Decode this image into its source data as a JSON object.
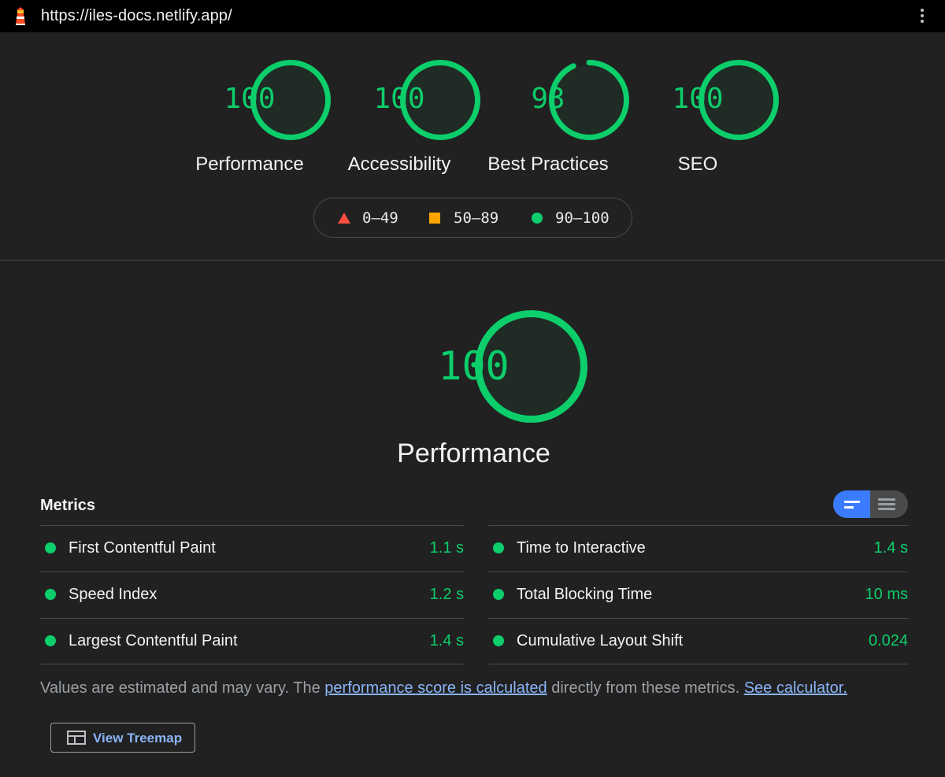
{
  "topbar": {
    "logo_icon": "lighthouse-icon",
    "url": "https://iles-docs.netlify.app/",
    "menu_icon": "kebab-menu-icon"
  },
  "scores": [
    {
      "label": "Performance",
      "value": "100",
      "score": 100
    },
    {
      "label": "Accessibility",
      "value": "100",
      "score": 100
    },
    {
      "label": "Best Practices",
      "value": "93",
      "score": 93
    },
    {
      "label": "SEO",
      "value": "100",
      "score": 100
    }
  ],
  "legend": {
    "fail": "0–49",
    "average": "50–89",
    "pass": "90–100"
  },
  "main_gauge": {
    "value": "100",
    "score": 100,
    "label": "Performance"
  },
  "metrics": {
    "title": "Metrics",
    "toggle": {
      "left_icon": "summary-view-icon",
      "right_icon": "expanded-view-icon",
      "active": "left"
    },
    "left": [
      {
        "name": "First Contentful Paint",
        "value": "1.1 s"
      },
      {
        "name": "Speed Index",
        "value": "1.2 s"
      },
      {
        "name": "Largest Contentful Paint",
        "value": "1.4 s"
      }
    ],
    "right": [
      {
        "name": "Time to Interactive",
        "value": "1.4 s"
      },
      {
        "name": "Total Blocking Time",
        "value": "10 ms"
      },
      {
        "name": "Cumulative Layout Shift",
        "value": "0.024"
      }
    ]
  },
  "note": {
    "text1": "Values are estimated and may vary. The ",
    "link1": "performance score is calculated",
    "text2": " directly from these metrics. ",
    "link2": "See calculator."
  },
  "treemap_button": {
    "icon": "treemap-icon",
    "label": "View Treemap"
  },
  "colors": {
    "pass": "#0cce6b",
    "average": "#ffa400",
    "fail": "#ff4e42",
    "toggle_active": "#3b7cff",
    "link": "#8ab4f8"
  }
}
